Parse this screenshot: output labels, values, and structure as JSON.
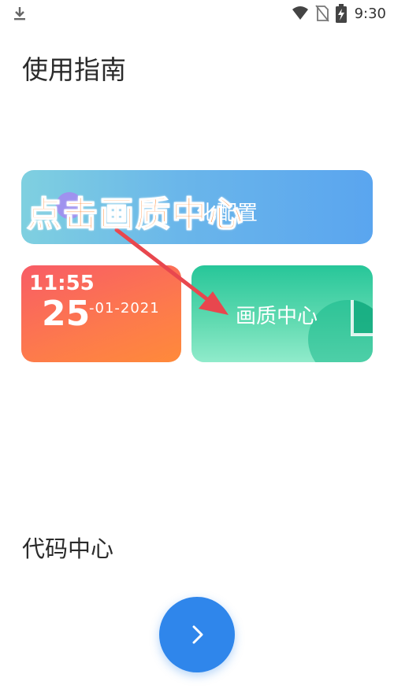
{
  "status_bar": {
    "time": "9:30",
    "icons": [
      "download-icon",
      "wifi-icon",
      "no-sim-icon",
      "battery-charging-icon"
    ]
  },
  "page": {
    "title": "使用指南",
    "section_title": "代码中心"
  },
  "cards": {
    "top": {
      "label": "化配置",
      "badge_color": "#a38cf0"
    },
    "date": {
      "time": "11:55",
      "day": "25",
      "month_year": "-01-2021"
    },
    "quality": {
      "label": "画质中心"
    }
  },
  "overlay": {
    "annotation": "点击画质中心",
    "annotation_color": "#ff8a35",
    "arrow_color": "#e8474e"
  },
  "next_button": {
    "icon": "chevron-right-icon",
    "color": "#2f86eb"
  }
}
